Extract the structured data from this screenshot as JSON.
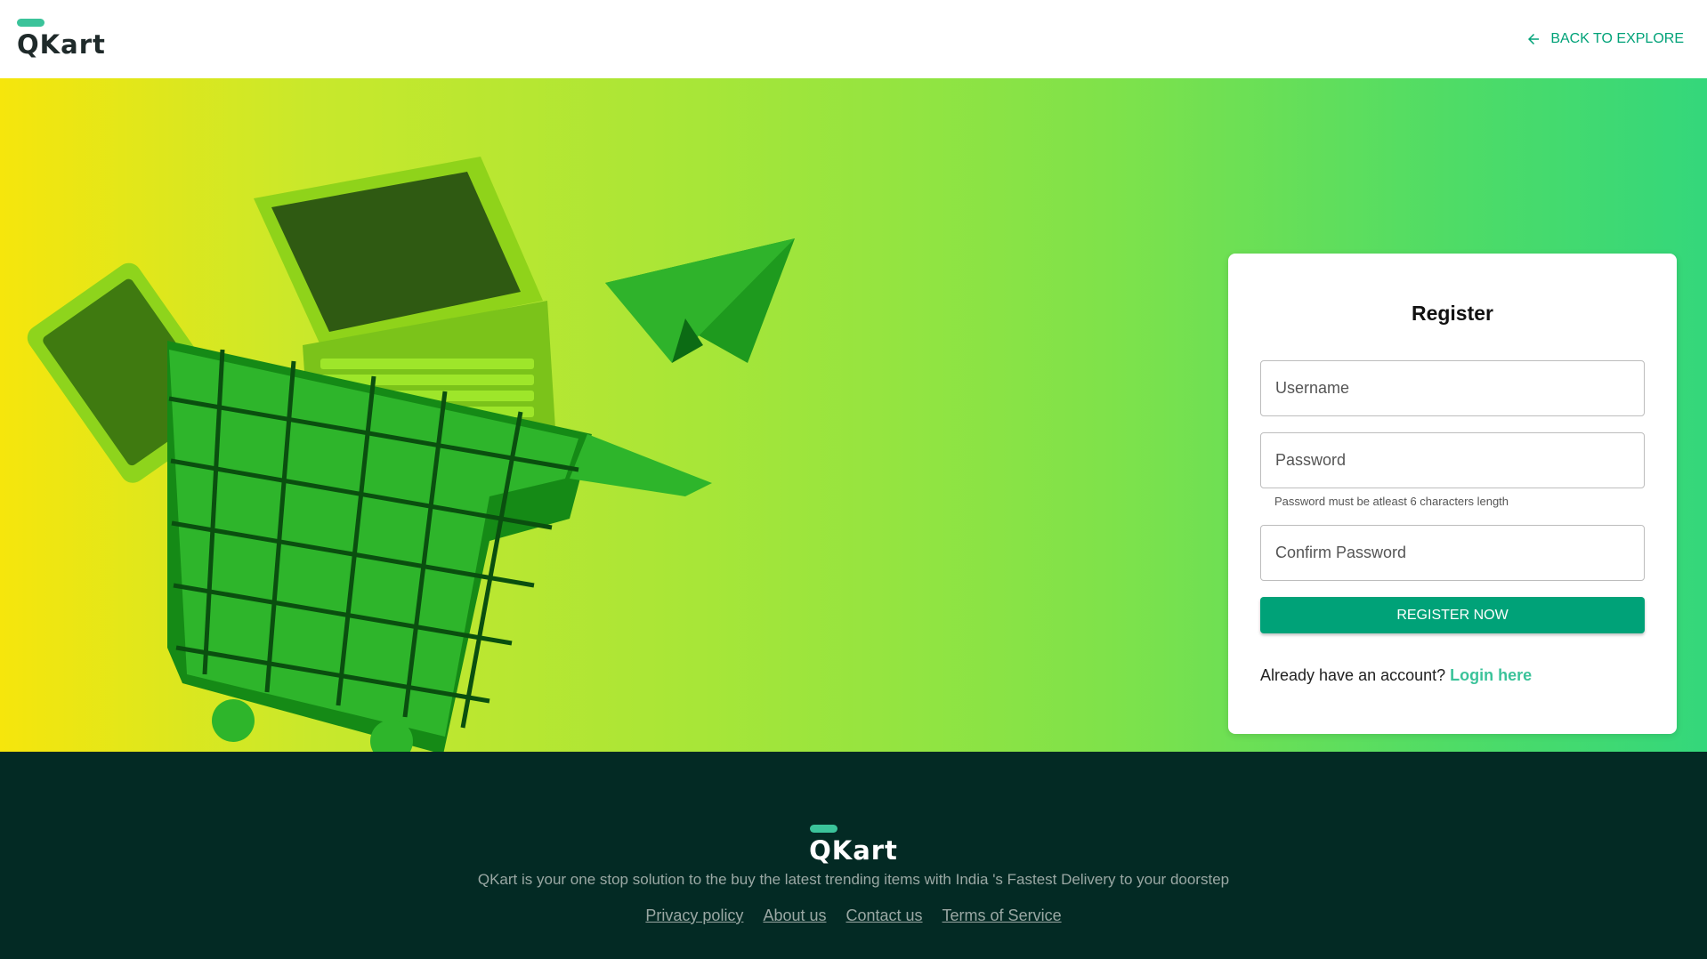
{
  "header": {
    "logo_text": "QKart",
    "back_label": "BACK TO EXPLORE",
    "back_icon": "arrow-left-icon"
  },
  "register": {
    "title": "Register",
    "username_placeholder": "Username",
    "password_placeholder": "Password",
    "password_helper": "Password must be atleast 6 characters length",
    "confirm_placeholder": "Confirm Password",
    "submit_label": "REGISTER NOW",
    "account_prompt": "Already have an account?",
    "login_link": "Login here"
  },
  "footer": {
    "logo_text": "QKart",
    "tagline": "QKart is your one stop solution to the buy the latest trending items with India 's Fastest Delivery to your doorstep",
    "links": [
      "Privacy policy",
      "About us",
      "Contact us",
      "Terms of Service"
    ]
  },
  "colors": {
    "accent": "#00a278",
    "logo_accent": "#3bc39a",
    "footer_bg": "#032a24",
    "hero_gradient": [
      "#f6e60c",
      "#a9e637",
      "#34d77b"
    ]
  }
}
